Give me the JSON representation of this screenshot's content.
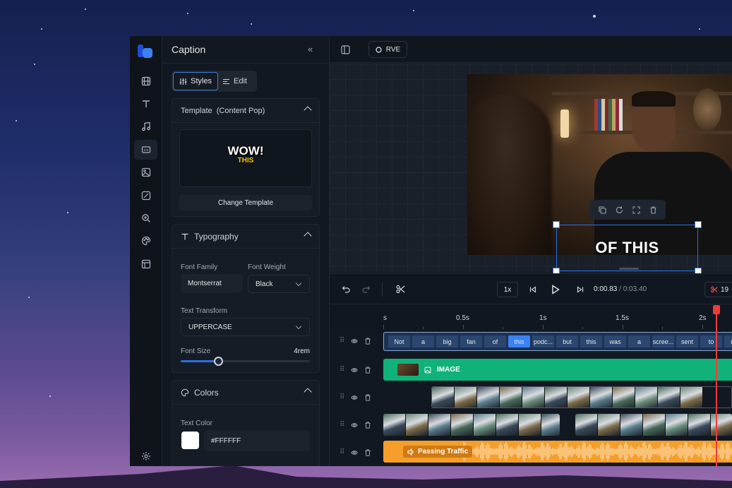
{
  "colors": {
    "accent": "#2f6fe0",
    "image_track": "#10b27a",
    "audio_track": "#f59e2a",
    "playhead": "#ef3b3b"
  },
  "panel": {
    "title": "Caption",
    "collapse_icon": "double-chevron-left-icon",
    "tabs": [
      {
        "label": "Styles",
        "icon": "sliders-icon"
      },
      {
        "label": "Edit",
        "icon": "lines-icon"
      }
    ],
    "template": {
      "header": "Template  (Content Pop)",
      "preview_line1": "WOW!",
      "preview_line2": "THIS",
      "change_button": "Change Template"
    },
    "typography": {
      "header": "Typography",
      "font_family_label": "Font Family",
      "font_family_value": "Montserrat",
      "font_weight_label": "Font Weight",
      "font_weight_value": "Black",
      "text_transform_label": "Text Transform",
      "text_transform_value": "UPPERCASE",
      "font_size_label": "Font Size",
      "font_size_value": "4rem",
      "font_size_level": 0.29
    },
    "colors": {
      "header": "Colors",
      "text_color_label": "Text Color",
      "text_color_value": "#FFFFFF"
    }
  },
  "rail": {
    "items": [
      "film-icon",
      "text-icon",
      "music-icon",
      "captions-icon",
      "image-icon",
      "sticker-icon",
      "zoom-icon",
      "palette-icon",
      "layout-icon",
      "settings-icon"
    ],
    "active": "captions-icon"
  },
  "topbar": {
    "project_label": "RVE"
  },
  "preview": {
    "caption_text": "OF THIS"
  },
  "controls": {
    "speed": "1x",
    "current_time": "0:00.83",
    "separator": "/",
    "total_time": "0:03.40",
    "render_label": "19"
  },
  "ruler": {
    "ticks": [
      "s",
      "0.5s",
      "1s",
      "1.5s",
      "2s"
    ]
  },
  "tracks": {
    "captions": [
      "Not",
      "a",
      "big",
      "fan",
      "of",
      "this",
      "podc...",
      "but",
      "this",
      "was",
      "a",
      "scree...",
      "sent",
      "to",
      "me"
    ],
    "highlighted_word": "this",
    "image_label": "IMAGE",
    "audio_label": "Passing Traffic"
  }
}
